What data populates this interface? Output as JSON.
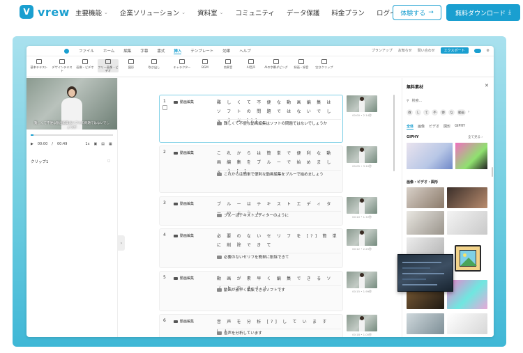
{
  "site": {
    "logo_text": "vrew",
    "nav": [
      {
        "label": "主要機能",
        "dropdown": true
      },
      {
        "label": "企業ソリューション",
        "dropdown": true
      },
      {
        "label": "資料室",
        "dropdown": true
      },
      {
        "label": "コミュニティ",
        "dropdown": false
      },
      {
        "label": "データ保護",
        "dropdown": false
      },
      {
        "label": "料金プラン",
        "dropdown": false
      },
      {
        "label": "ログイン",
        "dropdown": false
      }
    ],
    "try_button": "体験する",
    "download_button": "無料ダウンロード"
  },
  "app": {
    "menu": [
      "ファイル",
      "ホーム",
      "編集",
      "字幕",
      "書式",
      "挿入",
      "テンプレート",
      "効果",
      "ヘルプ"
    ],
    "active_menu": "挿入",
    "menu_right": [
      "プランアップ",
      "お知らせ",
      "問い合わせ",
      "エクスポート"
    ],
    "toolbar": [
      "基本テキスト",
      "デザインテキスト",
      "画像・ビデオ",
      "フリー画像・ビデオ",
      "図形",
      "吹き出し",
      "キャラクター",
      "BGM",
      "効果音",
      "AI音声",
      "AIの字幕ダビング",
      "録画・録音",
      "空きクリップ"
    ],
    "player": {
      "caption": "難しくて不便な動画編集はソフトの問題ではないでしょうか",
      "time": "00:00",
      "duration": "00:49",
      "speed": "1x",
      "progress_percent": 3,
      "clip_label": "クリップ1"
    },
    "clips": [
      {
        "num": "1",
        "speaker": "動画編集",
        "words": "難 し く て 不 便 な 動 画 編 集 は ソ フ ト の 問 題 で は な い で し ょ う か [?]",
        "subtitle": "難しくて不便な動画編集はソフトの問題ではないでしょうか",
        "time": "00:00 • 2.14秒"
      },
      {
        "num": "2",
        "speaker": "動画編集",
        "words": "こ れ か ら は 簡 単 で 便 利 な 動 画 編 集 を ブ ル ー で 始 め ま し ょ う [.]",
        "subtitle": "これからは簡単で便利な動画編集をブルーで始めましょう",
        "time": "00:05 • 3.10秒"
      },
      {
        "num": "3",
        "speaker": "動画編集",
        "words": "ブ ル ー は テ キ ス ト エ デ ィ タ ー の よ う に",
        "subtitle": "ブルーはテキストエディターのように",
        "time": "00:10 • 1.72秒"
      },
      {
        "num": "4",
        "speaker": "動画編集",
        "words": "必 要 の な い セ リ フ を [?] 簡 単 に 削 除 で き て",
        "subtitle": "必要のないセリフを簡単に削除できて",
        "time": "00:12 • 2.25秒"
      },
      {
        "num": "5",
        "speaker": "動画編集",
        "words": "動 画 が 素 早 く 編 集 で き る ソ フ ト で す [.]",
        "subtitle": "動画が素早く編集できるソフトです",
        "time": "00:15 • 1.99秒"
      },
      {
        "num": "6",
        "speaker": "動画編集",
        "words": "音 声 を 分 析 [?] し て い ま す [.]",
        "subtitle": "音声を分析しています",
        "time": "00:18 • 1.00秒"
      }
    ],
    "right_panel": {
      "title": "無料素材",
      "search_placeholder": "検索...",
      "chips": [
        "教",
        "し",
        "て",
        "不",
        "便",
        "な",
        "動画"
      ],
      "tabs": [
        "全体",
        "画像",
        "ビデオ",
        "図形",
        "GIPHY"
      ],
      "active_tab": "全体",
      "giphy_heading": "GIPHY",
      "see_all": "全て見る",
      "images_heading": "画像・ビデオ・図形"
    }
  }
}
